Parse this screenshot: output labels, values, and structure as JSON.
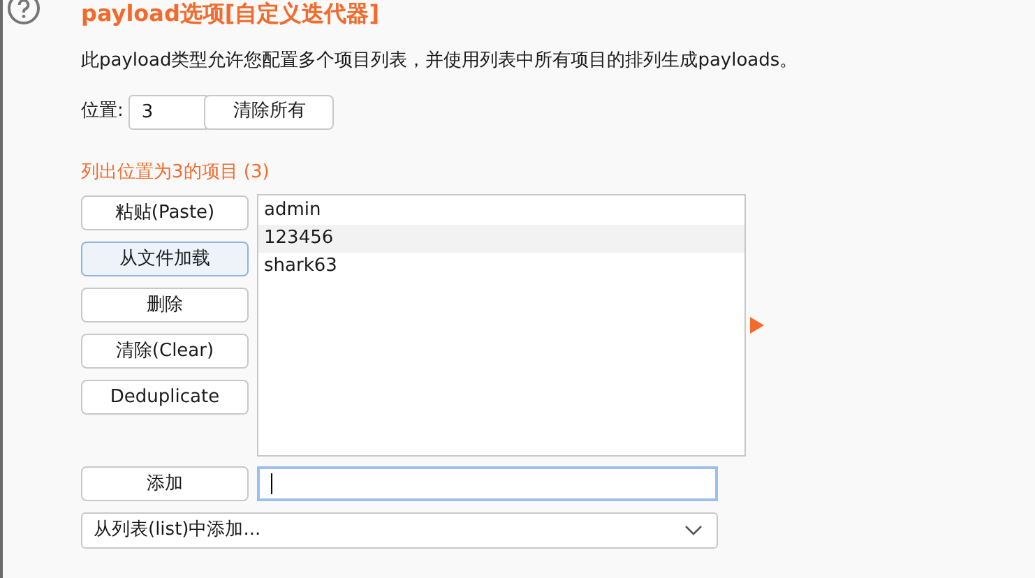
{
  "title": "payload选项[自定义迭代器]",
  "description": "此payload类型允许您配置多个项目列表，并使用列表中所有项目的排列生成payloads。",
  "position": {
    "label": "位置:",
    "value": "3",
    "clear_button": "清除所有"
  },
  "list_heading": "列出位置为3的项目 (3)",
  "side_buttons": [
    {
      "label": "粘贴(Paste)",
      "hovered": false
    },
    {
      "label": "从文件加载",
      "hovered": true
    },
    {
      "label": "删除",
      "hovered": false
    },
    {
      "label": "清除(Clear)",
      "hovered": false
    },
    {
      "label": "Deduplicate",
      "hovered": false
    }
  ],
  "items": [
    {
      "text": "admin",
      "selected": false
    },
    {
      "text": "123456",
      "selected": true
    },
    {
      "text": "shark63",
      "selected": false
    }
  ],
  "add_button": "添加",
  "add_field": {
    "focused": true
  },
  "dropdown": {
    "value": "从列表(list)中添加..."
  }
}
